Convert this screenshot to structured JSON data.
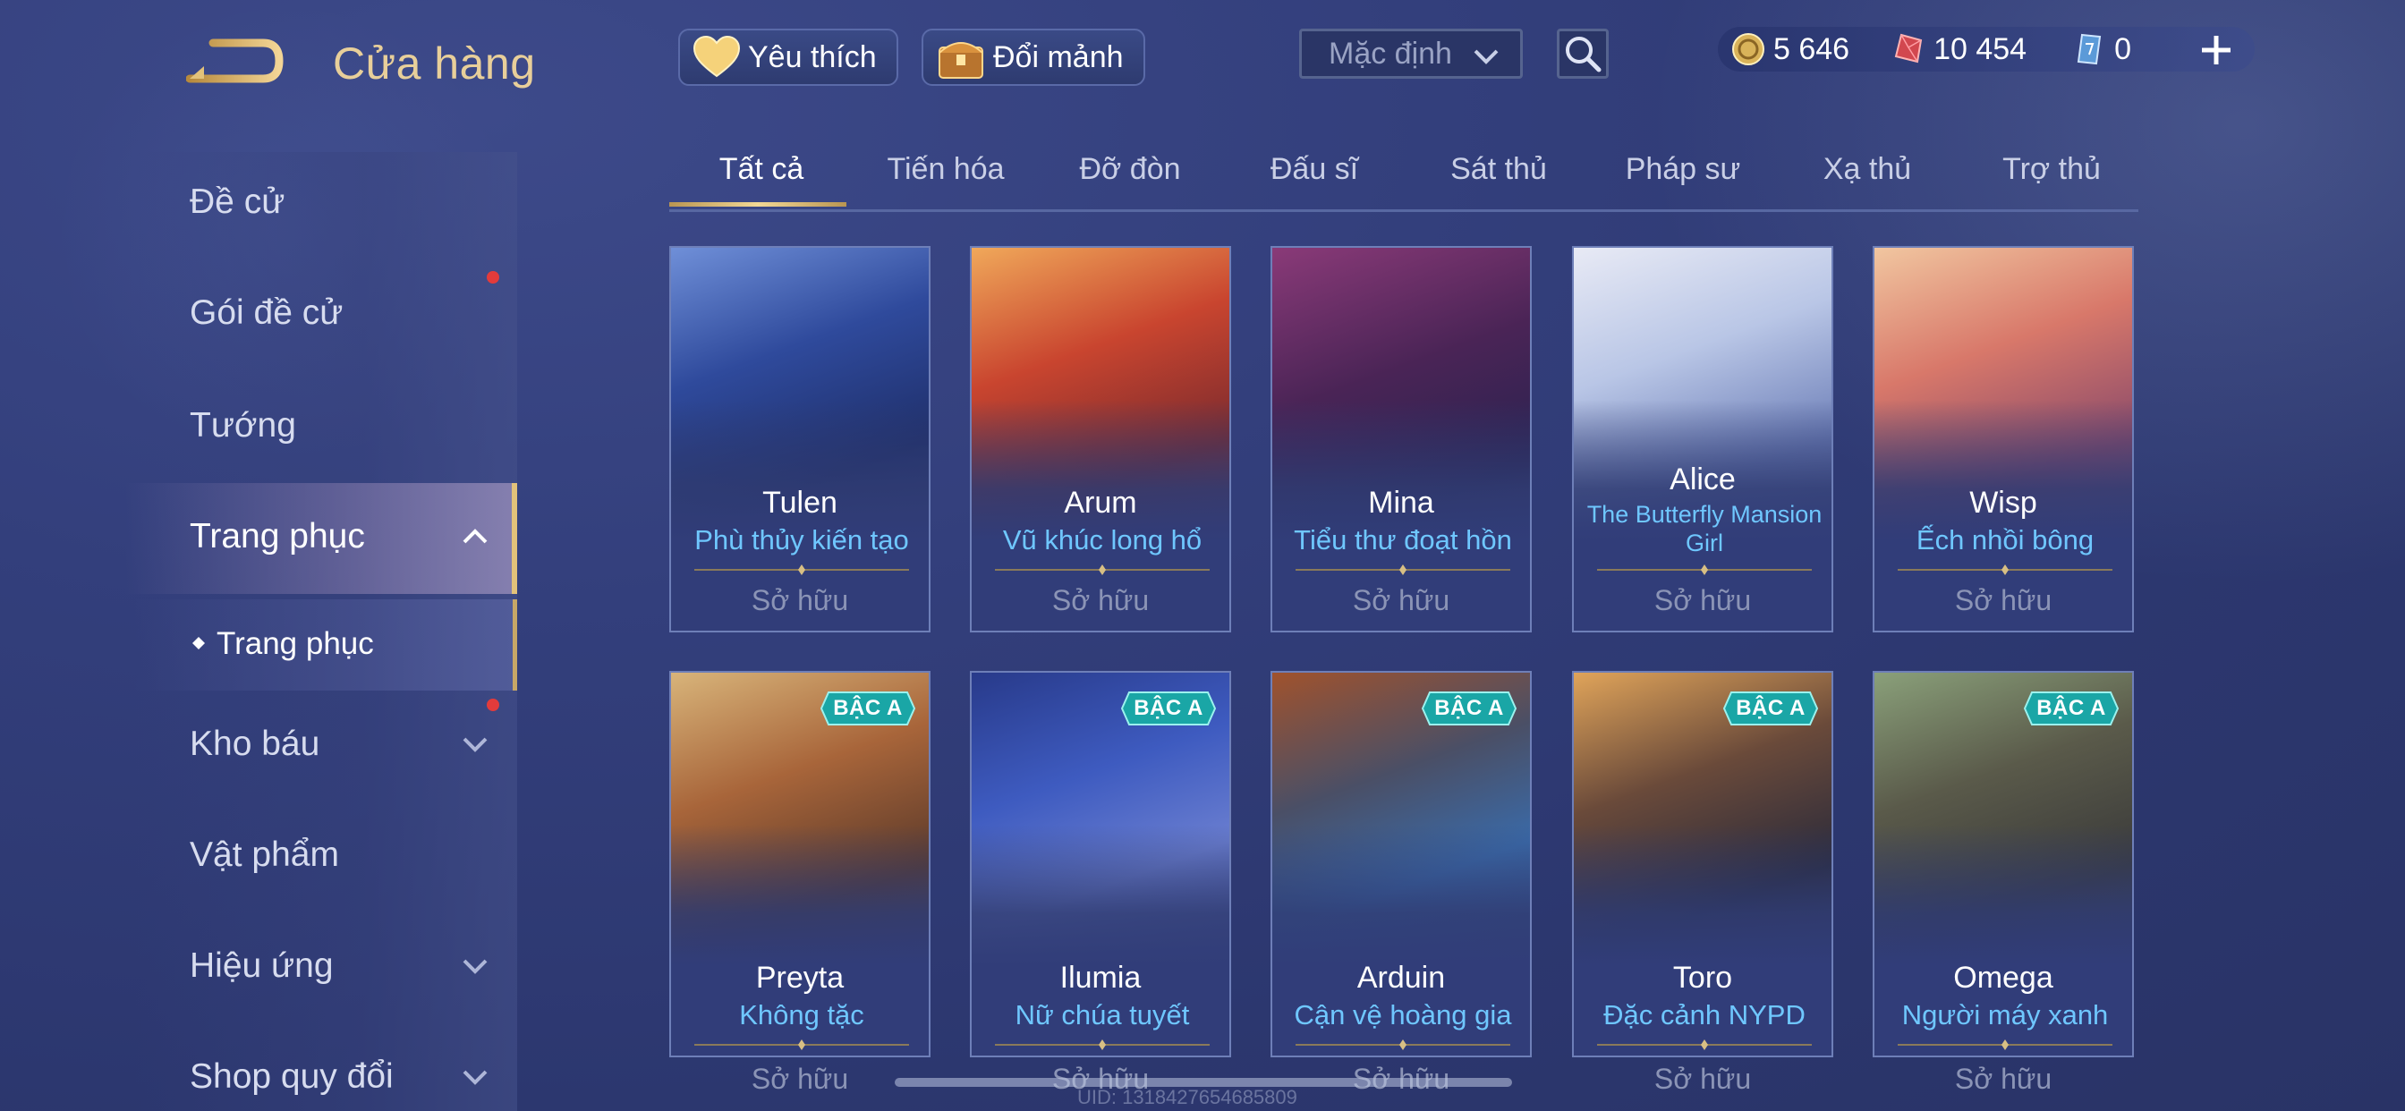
{
  "header": {
    "title": "Cửa hàng",
    "favorite_label": "Yêu thích",
    "shard_label": "Đổi mảnh",
    "sort_value": "Mặc định"
  },
  "currency": [
    {
      "icon": "gold-coin-icon",
      "value": "5 646"
    },
    {
      "icon": "ruby-gem-icon",
      "value": "10 454"
    },
    {
      "icon": "voucher-icon",
      "value": "0"
    }
  ],
  "sidebar": {
    "items": [
      {
        "label": "Đề cử"
      },
      {
        "label": "Gói đề cử"
      },
      {
        "label": "Tướng"
      },
      {
        "label": "Trang phục"
      },
      {
        "label": "Trang phục"
      },
      {
        "label": "Kho báu"
      },
      {
        "label": "Vật phẩm"
      },
      {
        "label": "Hiệu ứng"
      },
      {
        "label": "Shop quy đổi"
      }
    ]
  },
  "tabs": [
    "Tất cả",
    "Tiến hóa",
    "Đỡ đòn",
    "Đấu sĩ",
    "Sát thủ",
    "Pháp sư",
    "Xạ thủ",
    "Trợ thủ"
  ],
  "owned_label": "Sở hữu",
  "grade_label": "BẬC A",
  "cards": [
    {
      "hero": "Tulen",
      "skin": "Phù thủy kiến tạo"
    },
    {
      "hero": "Arum",
      "skin": "Vũ khúc long hổ"
    },
    {
      "hero": "Mina",
      "skin": "Tiểu thư đoạt hồn"
    },
    {
      "hero": "Alice",
      "skin": "The Butterfly Mansion Girl"
    },
    {
      "hero": "Wisp",
      "skin": "Ếch nhồi bông"
    },
    {
      "hero": "Preyta",
      "skin": "Không tặc"
    },
    {
      "hero": "Ilumia",
      "skin": "Nữ chúa tuyết"
    },
    {
      "hero": "Arduin",
      "skin": "Cận vệ hoàng gia"
    },
    {
      "hero": "Toro",
      "skin": "Đặc cảnh NYPD"
    },
    {
      "hero": "Omega",
      "skin": "Người máy xanh"
    }
  ],
  "uid": "UID: 1318427654685809",
  "colors": {
    "accent_gold": "#e3c27a",
    "skin_blue": "#6fc7ff",
    "badge_teal": "#1aa6a6"
  }
}
